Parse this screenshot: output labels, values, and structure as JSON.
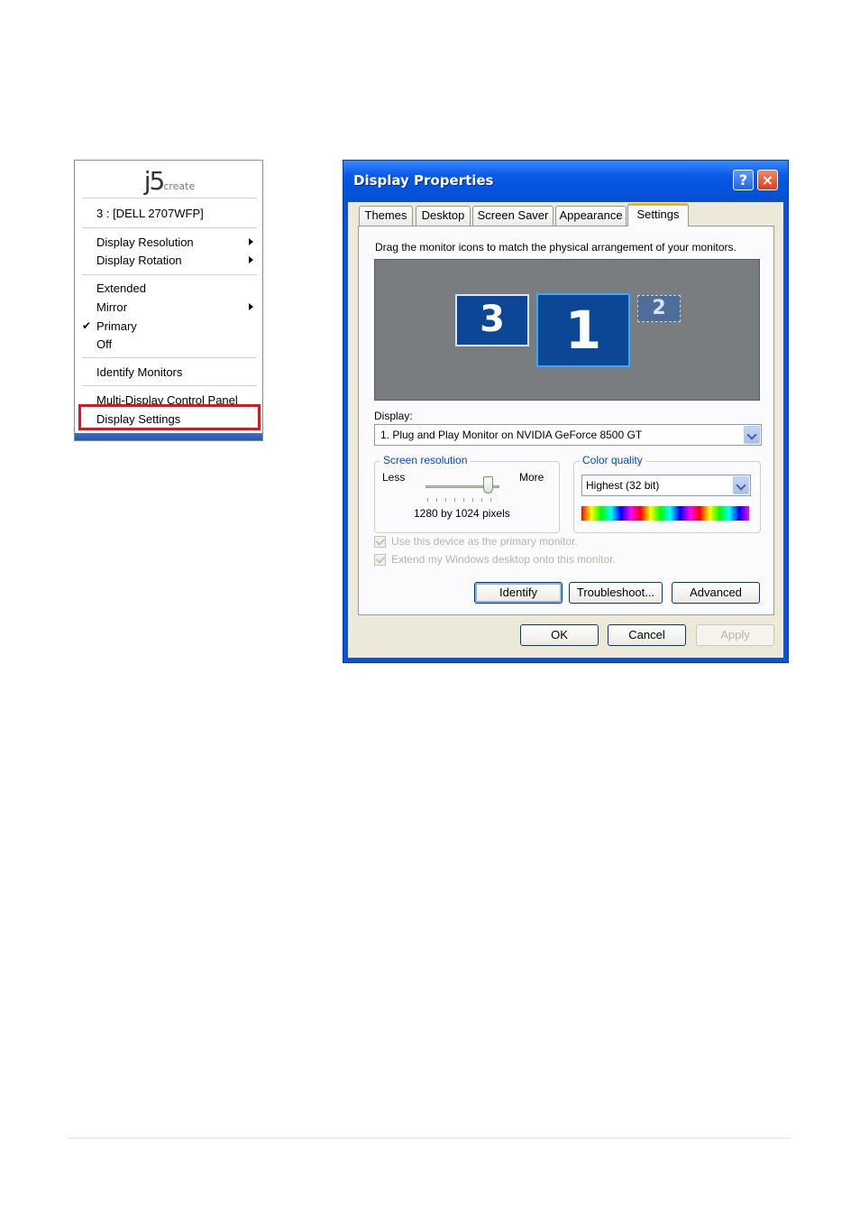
{
  "menu": {
    "logo_main": "j5",
    "logo_sub": "create",
    "monitor": "3 : [DELL 2707WFP]",
    "display_resolution": "Display Resolution",
    "display_rotation": "Display Rotation",
    "extended": "Extended",
    "mirror": "Mirror",
    "primary": "Primary",
    "off": "Off",
    "identify_monitors": "Identify Monitors",
    "control_panel": "Multi-Display Control Panel",
    "display_settings": "Display Settings",
    "checked_item": "Primary",
    "highlight_color": "#e2131b"
  },
  "dialog": {
    "title": "Display Properties",
    "help_icon": "?",
    "close_icon": "×",
    "tabs": [
      "Themes",
      "Desktop",
      "Screen Saver",
      "Appearance",
      "Settings"
    ],
    "active_tab": "Settings",
    "instruction": "Drag the monitor icons to match the physical arrangement of your monitors.",
    "monitors": [
      "3",
      "1",
      "2"
    ],
    "selected_monitor": "1",
    "display_label": "Display:",
    "display_value": "1. Plug and Play Monitor on NVIDIA GeForce 8500 GT",
    "resolution": {
      "title": "Screen resolution",
      "less": "Less",
      "more": "More",
      "value": "1280 by 1024 pixels",
      "slider_level": 0.85
    },
    "color_quality": {
      "title": "Color quality",
      "value": "Highest (32 bit)"
    },
    "checkbox_primary": "Use this device as the primary monitor.",
    "checkbox_extend": "Extend my Windows desktop onto this monitor.",
    "buttons": {
      "identify": "Identify",
      "troubleshoot": "Troubleshoot...",
      "advanced": "Advanced",
      "ok": "OK",
      "cancel": "Cancel",
      "apply": "Apply"
    },
    "titlebar_color": "#0a5ae8"
  }
}
